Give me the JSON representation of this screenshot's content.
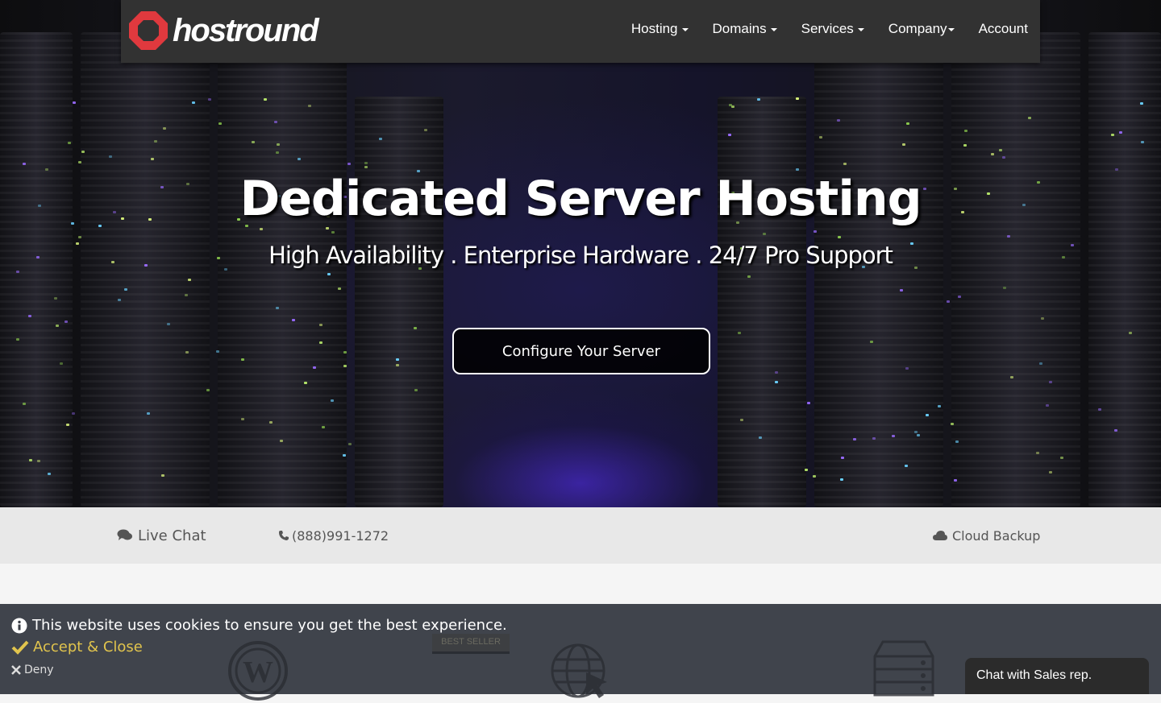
{
  "brand": {
    "logo_text": "hostround",
    "accent": "#e0393e"
  },
  "nav": {
    "items": [
      {
        "label": "Hosting",
        "dropdown": true
      },
      {
        "label": "Domains",
        "dropdown": true
      },
      {
        "label": "Services",
        "dropdown": true
      },
      {
        "label": "Company",
        "dropdown": true
      },
      {
        "label": "Account",
        "dropdown": false
      }
    ]
  },
  "hero": {
    "title": "Dedicated Server Hosting",
    "subtitle": "High Availability . Enterprise Hardware . 24/7 Pro Support",
    "cta": "Configure Your Server"
  },
  "infobar": {
    "live_chat": "Live Chat",
    "phone": "(888)991-1272",
    "cloud_backup": "Cloud Backup"
  },
  "cookie": {
    "message": "This website uses cookies to ensure you get the best experience.",
    "accept": "Accept & Close",
    "deny": "Deny"
  },
  "behind": {
    "badge": "BEST SELLER"
  },
  "chat_widget": {
    "label": "Chat with Sales rep."
  },
  "colors": {
    "navbar": "#323232",
    "cookie_bg": "#3a3e46",
    "accept": "#e1c44d"
  }
}
